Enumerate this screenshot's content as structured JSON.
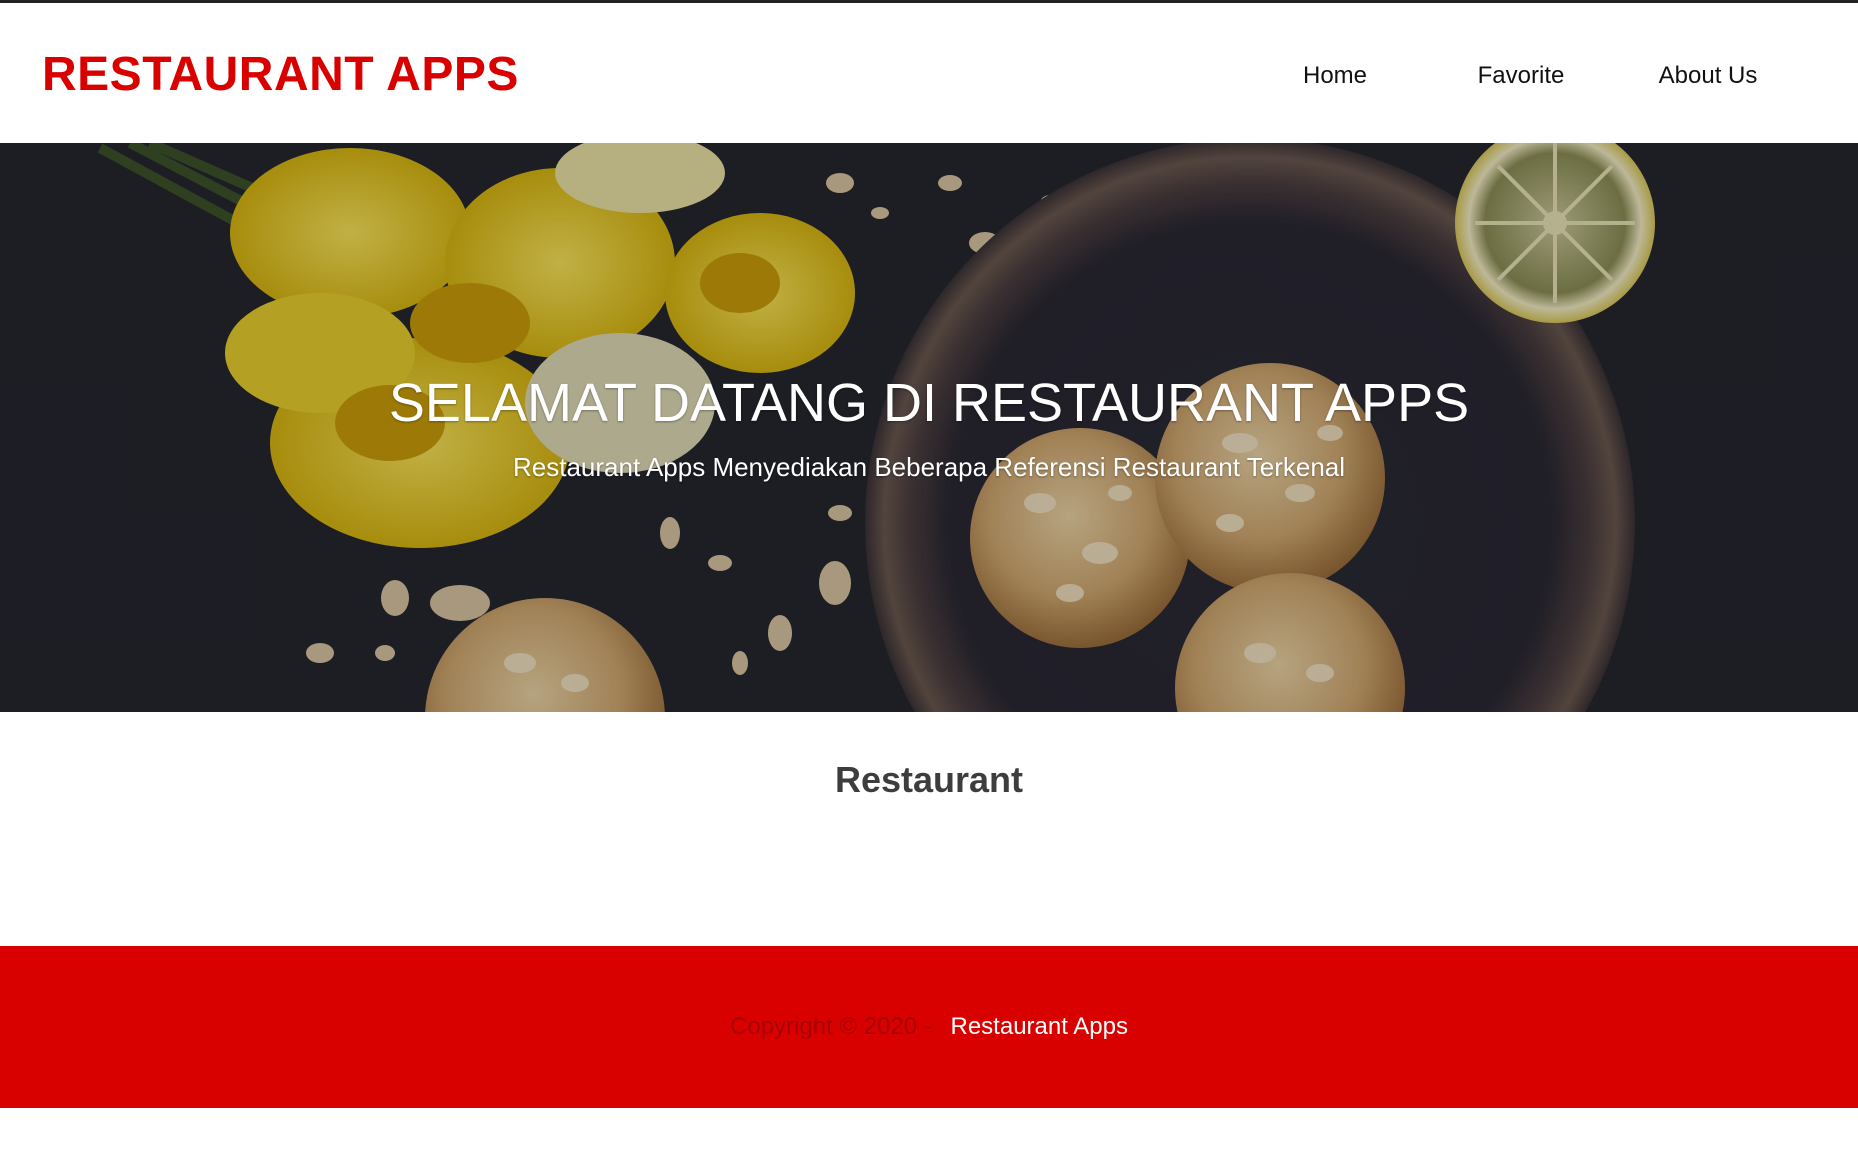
{
  "header": {
    "brand": "RESTAURANT APPS",
    "nav": [
      {
        "label": "Home"
      },
      {
        "label": "Favorite"
      },
      {
        "label": "About Us"
      }
    ]
  },
  "hero": {
    "title": "SELAMAT DATANG DI RESTAURANT APPS",
    "subtitle": "Restaurant Apps Menyediakan Beberapa Referensi Restaurant Terkenal",
    "image": "hero-food-photo"
  },
  "main": {
    "section_title": "Restaurant"
  },
  "footer": {
    "copyright": "Copyright © 2020 -",
    "brand": "Restaurant Apps"
  },
  "colors": {
    "brand": "#d90000",
    "footer_bg": "#d90000",
    "text_dark": "#3d3d3d"
  }
}
